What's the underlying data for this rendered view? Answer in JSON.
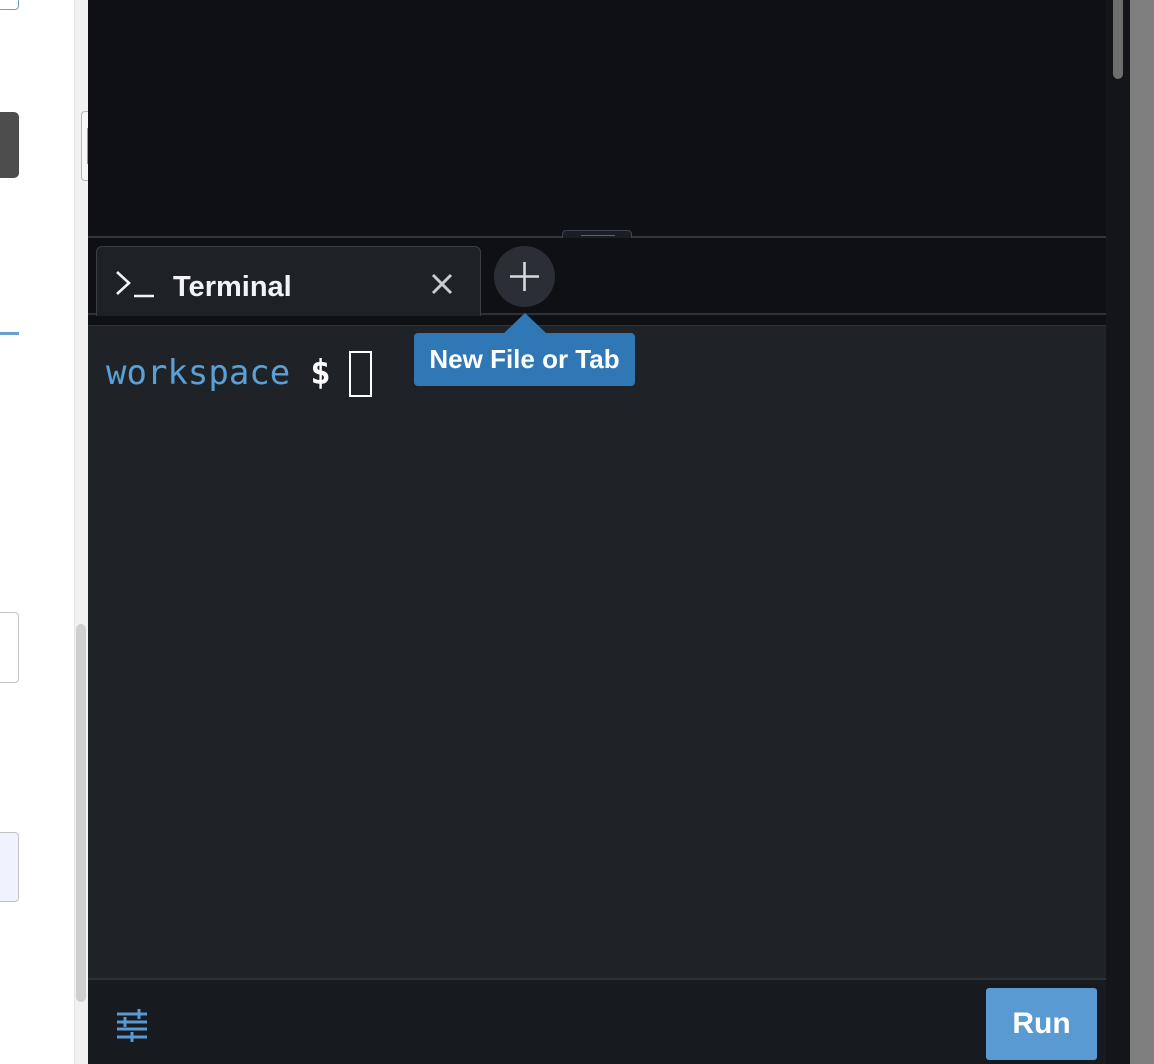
{
  "terminal_tab": {
    "icon": "terminal-prompt-icon",
    "label": "Terminal",
    "close_icon": "close-icon"
  },
  "add_tab": {
    "icon": "plus-icon"
  },
  "tooltip": {
    "text": "New File or Tab"
  },
  "terminal": {
    "directory": "workspace",
    "prompt_symbol": "$"
  },
  "footer": {
    "settings_icon": "sliders-icon",
    "run_label": "Run"
  },
  "colors": {
    "accent": "#5a9ad2",
    "tooltip_bg": "#2f78b5",
    "prompt_dir": "#5aa0d6",
    "terminal_bg": "#1f2328",
    "editor_bg": "#0e1014"
  }
}
